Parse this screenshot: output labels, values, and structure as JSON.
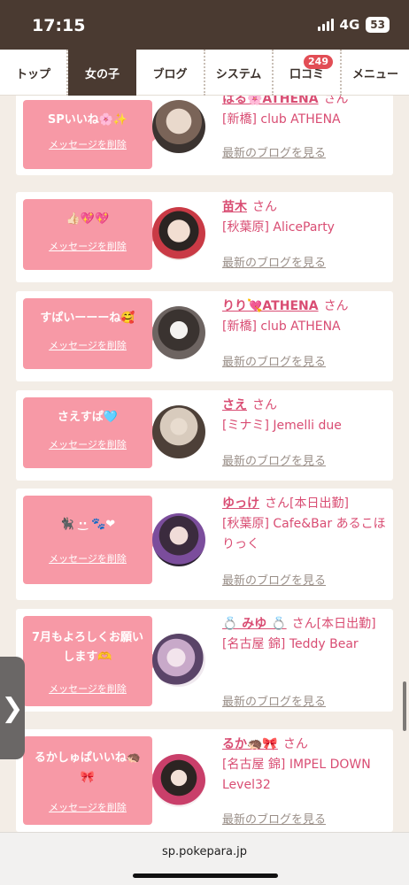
{
  "status": {
    "time": "17:15",
    "network": "4G",
    "battery": "53"
  },
  "tabs": [
    {
      "label": "トップ"
    },
    {
      "label": "女の子"
    },
    {
      "label": "ブログ"
    },
    {
      "label": "システム"
    },
    {
      "label": "口コミ",
      "badge": "249"
    },
    {
      "label": "メニュー"
    }
  ],
  "delete_label": "メッセージを削除",
  "blog_label": "最新のブログを見る",
  "san": "さん",
  "cards": [
    {
      "message": "SPいいね🌸✨",
      "name": "はる🌸ATHENA",
      "suffix": "",
      "shop": "[新橋] club ATHENA"
    },
    {
      "message": "👍🏻💖💖",
      "name": "苗木",
      "suffix": "",
      "shop": "[秋葉原] AliceParty"
    },
    {
      "message": "すぱいーーーね🥰",
      "name": "りり💘ATHENA",
      "suffix": "",
      "shop": "[新橋] club ATHENA"
    },
    {
      "message": "さえすぱ🩵",
      "name": "さえ",
      "suffix": "",
      "shop": "[ミナミ] Jemelli due"
    },
    {
      "message": "🐈‍⬛‪‪ ·͜· 🐾❤︎",
      "name": "ゆっけ",
      "suffix": "[本日出勤]",
      "shop": "[秋葉原] Cafe&Bar あるこほりっく"
    },
    {
      "message": "7月もよろしくお願いします🫶",
      "name": "💍 みゆ 💍",
      "suffix": "[本日出勤]",
      "shop": "[名古屋 錦] Teddy Bear"
    },
    {
      "message": "るかしゅぱいいね🦔🎀",
      "name": "るか🦔🎀",
      "suffix": "",
      "shop": "[名古屋 錦] IMPEL DOWN Level32"
    }
  ],
  "footer": {
    "url": "sp.pokepara.jp"
  },
  "colors": {
    "accent": "#d94d73",
    "bubble": "#f799a6",
    "header": "#4a3a31"
  }
}
